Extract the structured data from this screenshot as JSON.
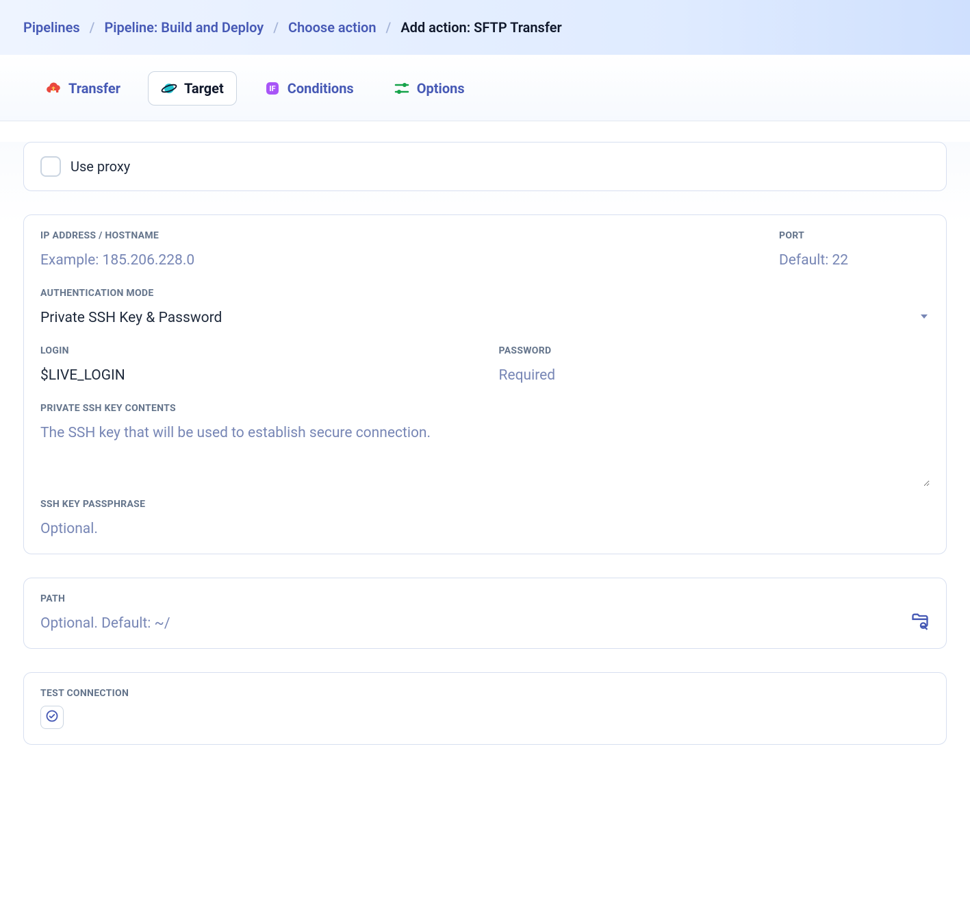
{
  "breadcrumb": {
    "pipelines": "Pipelines",
    "pipeline": "Pipeline: Build and Deploy",
    "choose_action": "Choose action",
    "current": "Add action: SFTP Transfer"
  },
  "tabs": {
    "transfer": "Transfer",
    "target": "Target",
    "conditions": "Conditions",
    "options": "Options"
  },
  "proxy": {
    "label": "Use proxy"
  },
  "form": {
    "host_label": "IP Address / Hostname",
    "host_placeholder": "Example: 185.206.228.0",
    "port_label": "Port",
    "port_placeholder": "Default: 22",
    "auth_label": "Authentication Mode",
    "auth_value": "Private SSH Key & Password",
    "login_label": "Login",
    "login_value": "$LIVE_LOGIN",
    "password_label": "Password",
    "password_placeholder": "Required",
    "sshkey_label": "Private SSH key contents",
    "sshkey_placeholder": "The SSH key that will be used to establish secure connection.",
    "passphrase_label": "SSH key passphrase",
    "passphrase_placeholder": "Optional.",
    "path_label": "Path",
    "path_placeholder": "Optional. Default: ~/",
    "test_label": "Test connection"
  }
}
